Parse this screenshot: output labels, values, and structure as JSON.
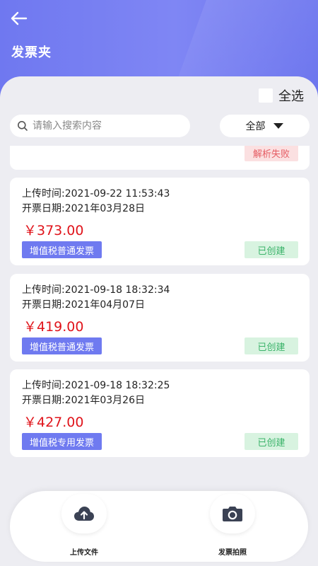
{
  "header": {
    "title": "发票夹"
  },
  "toolbar": {
    "select_all_label": "全选",
    "search_placeholder": "请输入搜索内容",
    "filter_label": "全部"
  },
  "partial_card": {
    "status": "解析失败"
  },
  "invoices": [
    {
      "upload_time": "上传时间:2021-09-22 11:53:43",
      "issue_date": "开票日期:2021年03月28日",
      "amount": "￥373.00",
      "type": "增值税普通发票",
      "status": "已创建"
    },
    {
      "upload_time": "上传时间:2021-09-18 18:32:34",
      "issue_date": "开票日期:2021年04月07日",
      "amount": "￥419.00",
      "type": "增值税普通发票",
      "status": "已创建"
    },
    {
      "upload_time": "上传时间:2021-09-18 18:32:25",
      "issue_date": "开票日期:2021年03月26日",
      "amount": "￥427.00",
      "type": "增值税专用发票",
      "status": "已创建"
    }
  ],
  "bottom_bar": {
    "upload_label": "上传文件",
    "photo_label": "发票拍照"
  },
  "colors": {
    "header_accent": "#6f78f0",
    "amount_red": "#e0141b",
    "type_tag": "#6f7af0",
    "status_ok_bg": "#d8f3e0",
    "status_ok_text": "#3bb36a",
    "status_fail_bg": "#fbe0e1",
    "status_fail_text": "#e55b62",
    "icon_dark": "#3b4254"
  },
  "icons": {
    "back": "arrow-left-icon",
    "search": "search-icon",
    "filter": "caret-down-icon",
    "upload": "cloud-upload-icon",
    "photo": "camera-icon"
  }
}
